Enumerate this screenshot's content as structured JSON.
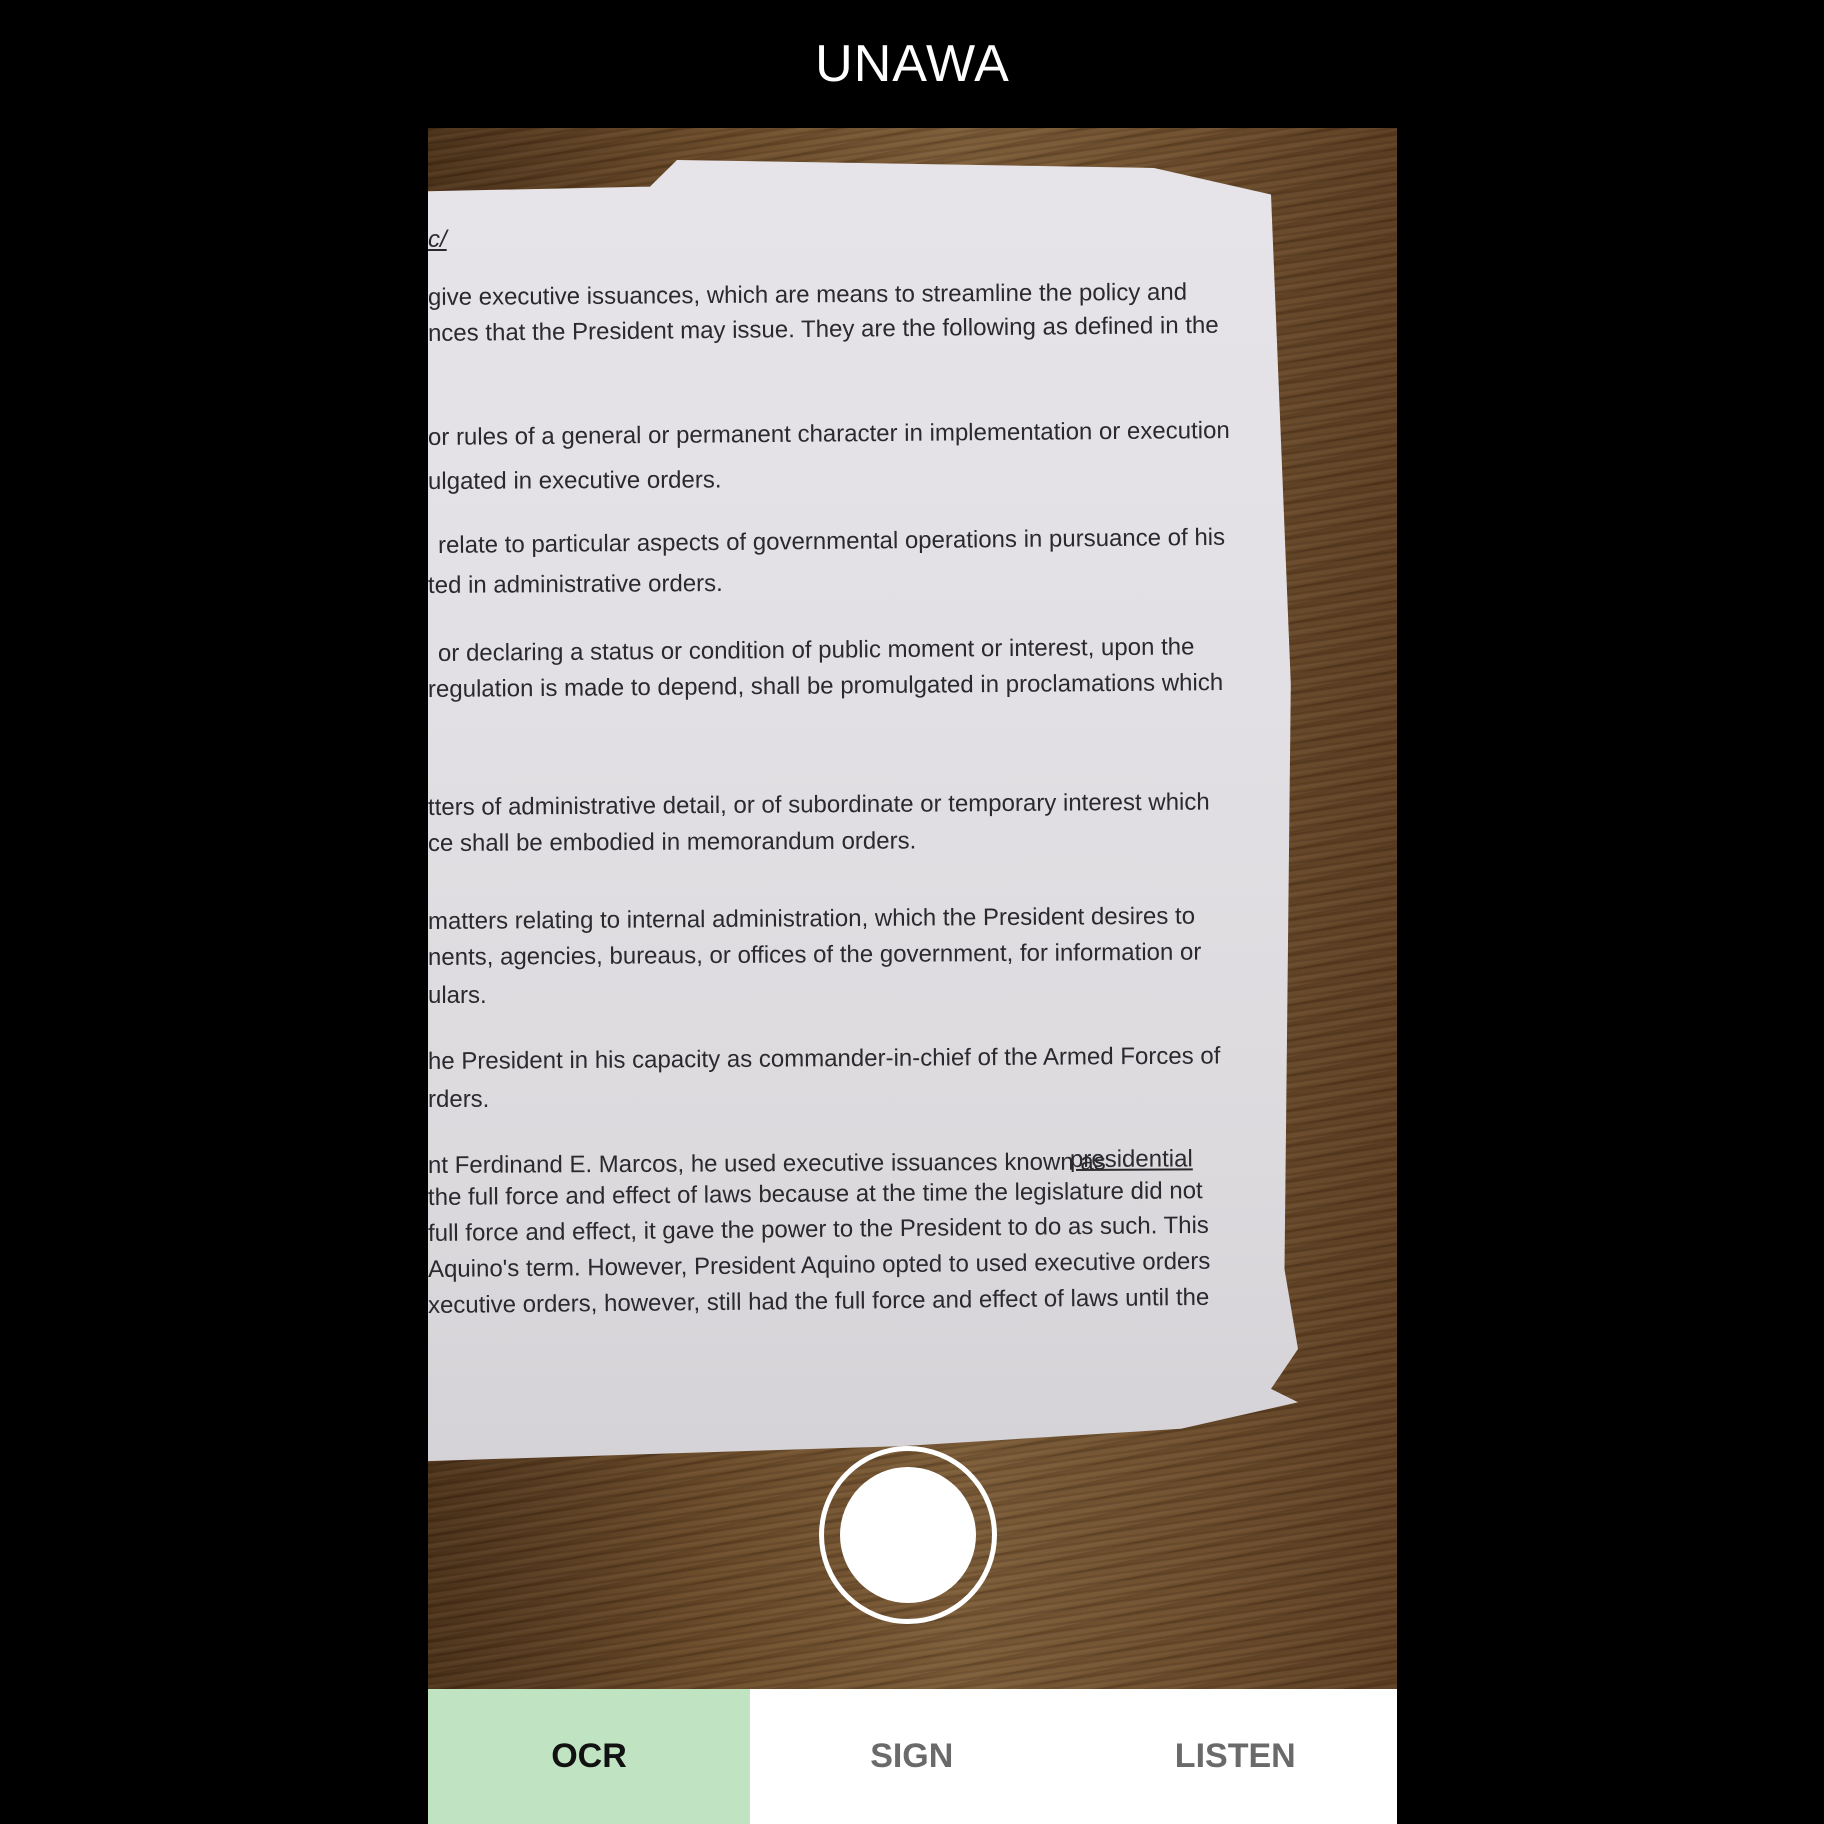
{
  "app": {
    "title": "UNAWA"
  },
  "document": {
    "lines": [
      "c/",
      "give executive issuances, which are means to streamline the policy and",
      "nces that the President may issue. They are the following as defined in the",
      "or rules of a general or permanent character in implementation or execution",
      "ulgated in executive orders.",
      "relate to particular aspects of governmental operations in pursuance of his",
      "ted in administrative orders.",
      "or declaring a status or condition of public moment or interest, upon the",
      "regulation is made to depend, shall be promulgated in proclamations which",
      "tters of administrative detail, or of subordinate or temporary interest which",
      "ce shall be embodied in memorandum orders.",
      "matters relating to internal administration, which the President desires to",
      "nents, agencies, bureaus, or offices of the government, for information or",
      "ulars.",
      "he President in his capacity as commander-in-chief of the Armed Forces of",
      "rders.",
      "nt Ferdinand E. Marcos, he used executive issuances known as",
      "presidential",
      "the full force and effect of laws because at the time the legislature did not",
      "full force and effect, it gave the power to the President to do as such. This",
      "Aquino's term. However, President Aquino opted to used executive orders",
      "xecutive orders, however, still had the full force and effect of laws until the"
    ]
  },
  "camera": {
    "capture_label": ""
  },
  "tabs": [
    {
      "label": "OCR",
      "active": true
    },
    {
      "label": "SIGN",
      "active": false
    },
    {
      "label": "LISTEN",
      "active": false
    }
  ]
}
